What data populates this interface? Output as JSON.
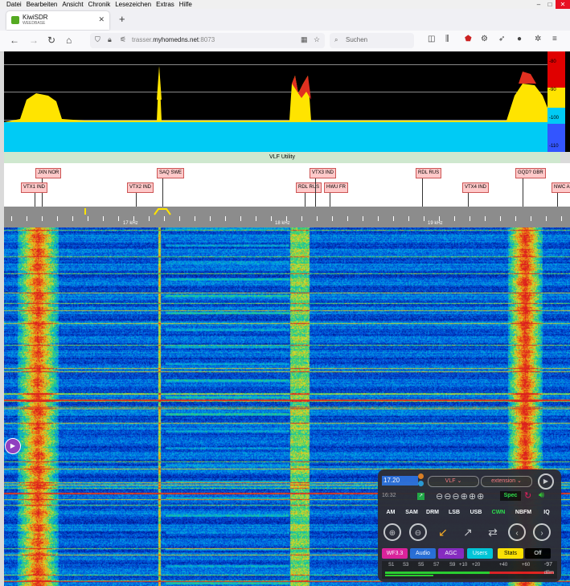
{
  "menubar": [
    "Datei",
    "Bearbeiten",
    "Ansicht",
    "Chronik",
    "Lesezeichen",
    "Extras",
    "Hilfe"
  ],
  "tab": {
    "title": "KiwiSDR",
    "subtitle": "WEEDBASE",
    "close": "✕"
  },
  "newtab": "+",
  "url": {
    "prefix": "trasser.",
    "domain": "myhomedns.net",
    "suffix": ":8073"
  },
  "search_placeholder": "Suchen",
  "colors": {
    "cyan": "#00cbf5",
    "accent": "#ffe400",
    "panel": "#2e2e36"
  },
  "spectrum": {
    "scale_labels": [
      "-80",
      "-90",
      "-100",
      "-110"
    ]
  },
  "band_label": "VLF Utility",
  "stations": [
    {
      "name": "JXN NOR"
    },
    {
      "name": "VTX1 IND"
    },
    {
      "name": "VTX2 IND"
    },
    {
      "name": "SAQ SWE"
    },
    {
      "name": "RDL RUS"
    },
    {
      "name": "HWU FR"
    },
    {
      "name": "VTX3 IND"
    },
    {
      "name": "RDL RUS"
    },
    {
      "name": "VTX4 IND"
    },
    {
      "name": "GQD? GBR"
    },
    {
      "name": "NWC AUS"
    }
  ],
  "ruler_labels": [
    "17 kHz",
    "18 kHz",
    "19 kHz"
  ],
  "panel": {
    "freq": "17.20",
    "band": "VLF",
    "ext": "extension",
    "time": "16:32",
    "spec": "Spec",
    "modes": [
      "AM",
      "SAM",
      "DRM",
      "LSB",
      "USB",
      "CWN",
      "NBFM",
      "IQ"
    ],
    "buttons": [
      {
        "label": "WF3.3",
        "bg": "#e0209a",
        "fg": "#fff"
      },
      {
        "label": "Audio",
        "bg": "#2a6fd6",
        "fg": "#fff"
      },
      {
        "label": "AGC",
        "bg": "#8a2ac0",
        "fg": "#fff"
      },
      {
        "label": "Users",
        "bg": "#00c8d8",
        "fg": "#fff"
      },
      {
        "label": "Stats",
        "bg": "#ffe400",
        "fg": "#000"
      },
      {
        "label": "Off",
        "bg": "#000",
        "fg": "#fff"
      }
    ],
    "smeter_labels": [
      "S1",
      "S3",
      "S5",
      "S7",
      "S9",
      "+10",
      "+20",
      "+40",
      "+60"
    ],
    "dbm": "-97",
    "dbm_unit": "dBm"
  }
}
